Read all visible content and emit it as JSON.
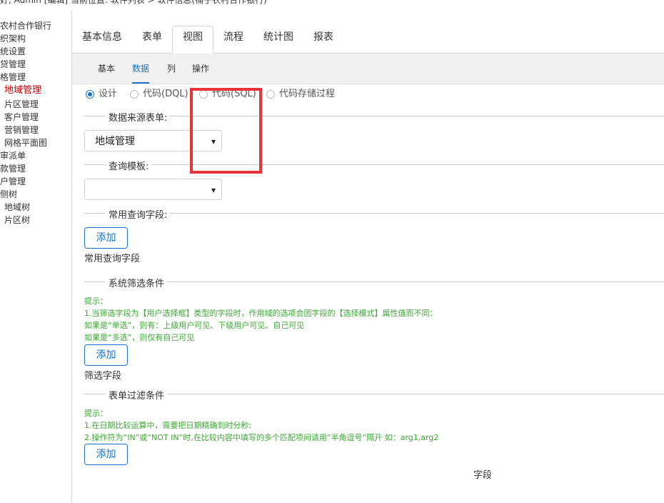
{
  "topbar": {
    "text": "好, Admin [编辑]  当前位置: 软件列表 > 软件信息(桶子农村合作银行)"
  },
  "sidebar": {
    "items": [
      {
        "label": "农村合作银行"
      },
      {
        "label": "织架构"
      },
      {
        "label": "统设置"
      },
      {
        "label": "贷管理"
      },
      {
        "label": "格管理"
      },
      {
        "label": "地域管理",
        "active": true
      },
      {
        "label": "片区管理"
      },
      {
        "label": "客户管理"
      },
      {
        "label": "营销管理"
      },
      {
        "label": "网格平面图"
      },
      {
        "label": "审派单"
      },
      {
        "label": "款管理"
      },
      {
        "label": "户管理"
      },
      {
        "label": "侧树"
      },
      {
        "label": "地域树"
      },
      {
        "label": "片区树"
      }
    ]
  },
  "tabs": [
    {
      "label": "基本信息"
    },
    {
      "label": "表单"
    },
    {
      "label": "视图",
      "active": true
    },
    {
      "label": "流程"
    },
    {
      "label": "统计图"
    },
    {
      "label": "报表"
    }
  ],
  "subtabs": [
    {
      "label": "基本"
    },
    {
      "label": "数据",
      "active": true
    },
    {
      "label": "列"
    },
    {
      "label": "操作"
    }
  ],
  "radios": [
    {
      "label": "设计",
      "checked": true
    },
    {
      "label": "代码(DQL)",
      "checked": false
    },
    {
      "label": "代码(SQL)",
      "checked": false
    },
    {
      "label": "代码存储过程",
      "checked": false
    }
  ],
  "sections": {
    "source_table": {
      "legend": "数据来源表单:",
      "selected": "地域管理"
    },
    "query_template": {
      "legend": "查询模板:",
      "selected": ""
    },
    "common_fields": {
      "legend": "常用查询字段:",
      "add": "添加",
      "caption": "常用查询字段"
    },
    "system_filter": {
      "legend": "系统筛选条件",
      "hints": [
        "提示：",
        "1.当筛选字段为【用户选择框】类型的字段时，作用域的选项会因字段的【选择模式】属性值而不同：",
        "  如果是“单选”，则有：上级用户可见、下级用户可见、自己可见",
        "  如果是“多选”，则仅有自己可见"
      ],
      "add": "添加",
      "caption": "筛选字段"
    },
    "form_filter": {
      "legend": "表单过滤条件",
      "hints": [
        "提示：",
        "1.在日期比较运算中，需要把日期精确到时分秒;",
        "2.操作符为“IN”或“NOT IN”时,在比较内容中填写的多个匹配项间请用“半角逗号”隔开 如：arg1,arg2"
      ],
      "add": "添加",
      "column": "字段"
    }
  },
  "colors": {
    "accent": "#1a73c6",
    "highlight_box": "#e8333b",
    "hint_text": "#3aa832",
    "active_nav": "#d00000"
  }
}
